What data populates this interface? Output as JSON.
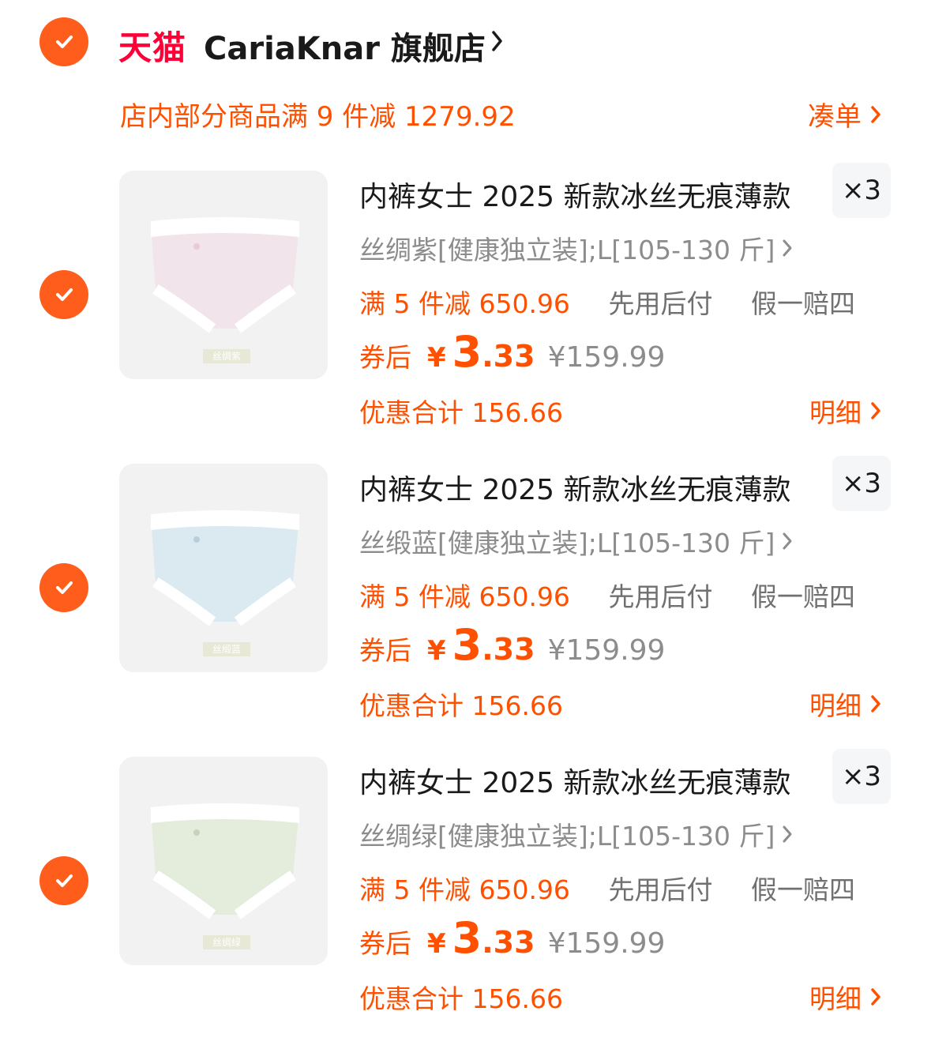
{
  "store": {
    "brand_logo": "天猫",
    "name": "CariaKnar 旗舰店",
    "promo_text": "店内部分商品满 9 件减 1279.92",
    "promo_link": "凑单"
  },
  "colors": {
    "accent": "#ff5000",
    "check": "#ff5d1b",
    "tmall_red": "#ff0036"
  },
  "items": [
    {
      "title": "内裤女士 2025 新款冰丝无痕薄款",
      "quantity": "×3",
      "spec": "丝绸紫[健康独立装];L[105-130 斤]",
      "thumb_tag": "丝绸紫",
      "thumb_color": "#f1e4ea",
      "tags": {
        "discount": "满 5 件减 650.96",
        "pay_later": "先用后付",
        "guarantee": "假一赔四"
      },
      "price_label": "券后",
      "currency": "¥",
      "price_int": "3",
      "price_dec": ".33",
      "original_price": "¥159.99",
      "saving": "优惠合计 156.66",
      "detail_link": "明细"
    },
    {
      "title": "内裤女士 2025 新款冰丝无痕薄款",
      "quantity": "×3",
      "spec": "丝缎蓝[健康独立装];L[105-130 斤]",
      "thumb_tag": "丝缎蓝",
      "thumb_color": "#dbe9f1",
      "tags": {
        "discount": "满 5 件减 650.96",
        "pay_later": "先用后付",
        "guarantee": "假一赔四"
      },
      "price_label": "券后",
      "currency": "¥",
      "price_int": "3",
      "price_dec": ".33",
      "original_price": "¥159.99",
      "saving": "优惠合计 156.66",
      "detail_link": "明细"
    },
    {
      "title": "内裤女士 2025 新款冰丝无痕薄款",
      "quantity": "×3",
      "spec": "丝绸绿[健康独立装];L[105-130 斤]",
      "thumb_tag": "丝绸绿",
      "thumb_color": "#e4ecdc",
      "tags": {
        "discount": "满 5 件减 650.96",
        "pay_later": "先用后付",
        "guarantee": "假一赔四"
      },
      "price_label": "券后",
      "currency": "¥",
      "price_int": "3",
      "price_dec": ".33",
      "original_price": "¥159.99",
      "saving": "优惠合计 156.66",
      "detail_link": "明细"
    }
  ]
}
